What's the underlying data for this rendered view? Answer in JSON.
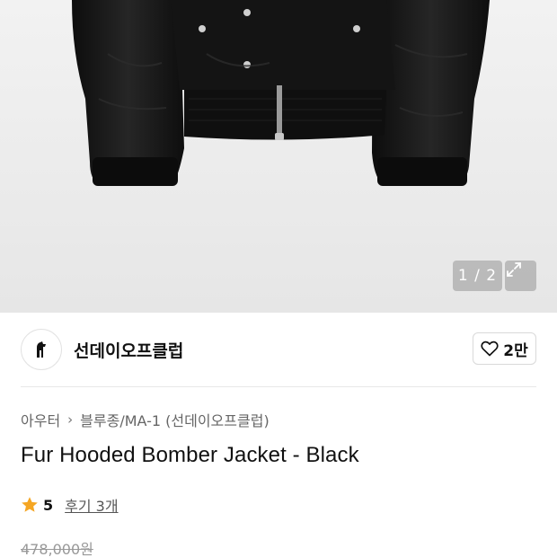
{
  "gallery": {
    "counter": "1 / 2",
    "image_alt": "Black bomber jacket product photo",
    "expand_icon": "expand-icon"
  },
  "brand": {
    "name": "선데이오프클럽",
    "logo_icon": "brand-logo-icon",
    "likes": "2만",
    "like_icon": "heart-icon"
  },
  "breadcrumb": {
    "category": "아우터",
    "subcategory": "블루종/MA-1 (선데이오프클럽)"
  },
  "product": {
    "title": "Fur Hooded Bomber Jacket - Black",
    "rating": "5",
    "reviews": "후기 3개",
    "original_price": "478,000원"
  },
  "colors": {
    "star": "#f5a623",
    "hero_bg": "#ededed",
    "jacket": "#161616"
  }
}
